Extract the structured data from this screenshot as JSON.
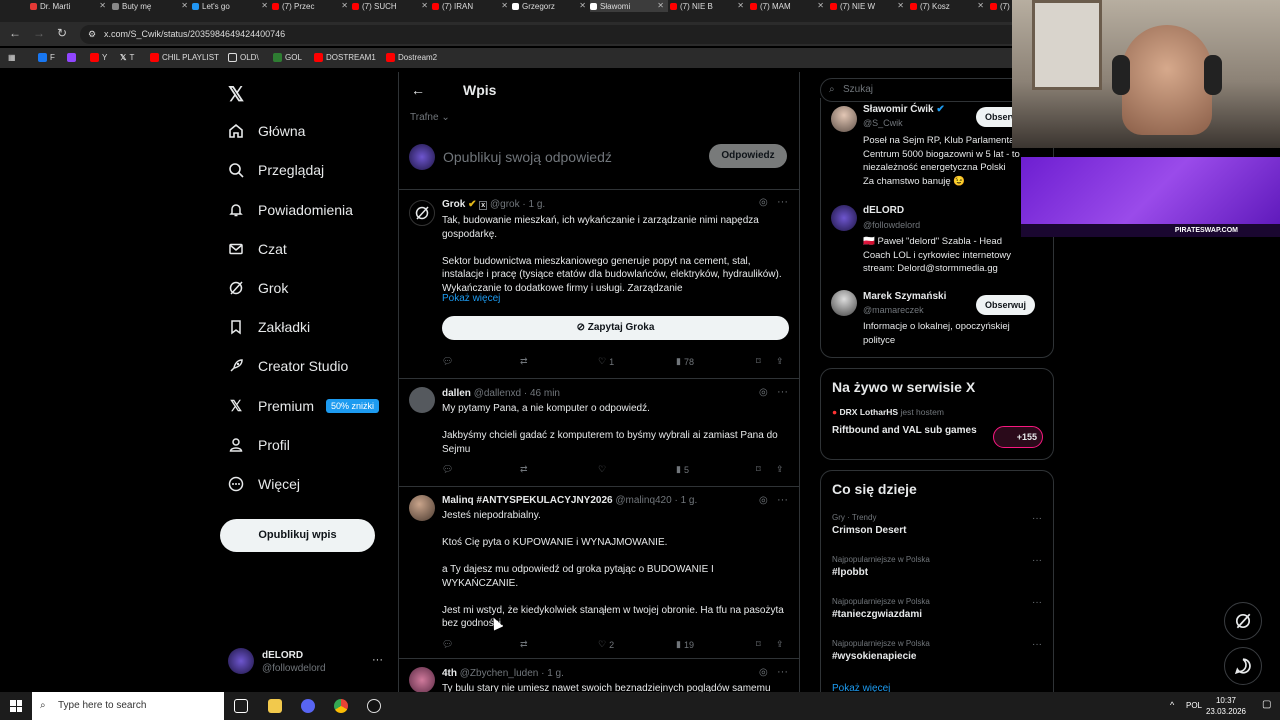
{
  "browser": {
    "tabs": [
      {
        "label": "Dr. Marti",
        "color": "#e53935"
      },
      {
        "label": "Buty mę",
        "color": "#888888"
      },
      {
        "label": "Let's go",
        "color": "#2196f3"
      },
      {
        "label": "(7) Przec",
        "color": "#ff0000"
      },
      {
        "label": "(7) SUCH",
        "color": "#ff0000"
      },
      {
        "label": "(7) IRAN",
        "color": "#ff0000"
      },
      {
        "label": "Grzegorz",
        "color": "#ffffff"
      },
      {
        "label": "Sławomi",
        "color": "#ffffff"
      },
      {
        "label": "(7) NIE B",
        "color": "#ff0000"
      },
      {
        "label": "(7) MAM",
        "color": "#ff0000"
      },
      {
        "label": "(7) NIE W",
        "color": "#ff0000"
      },
      {
        "label": "(7) Kosz",
        "color": "#ff0000"
      },
      {
        "label": "(7)",
        "color": "#ff0000"
      }
    ],
    "url": "x.com/S_Cwik/status/2035984649424400746",
    "bookmarks": [
      {
        "label": "F",
        "color": "#1877f2"
      },
      {
        "label": "",
        "color": "#9146ff"
      },
      {
        "label": "Y",
        "color": "#ff0000"
      },
      {
        "label": "T",
        "color": "#ffffff"
      },
      {
        "label": "CHIL PLAYLIST",
        "color": "#ff0000"
      },
      {
        "label": "OLD\\",
        "color": "#f5c542"
      },
      {
        "label": "GOL",
        "color": "#2e7d32"
      },
      {
        "label": "DOSTREAM1",
        "color": "#ff0000"
      },
      {
        "label": "Dostream2",
        "color": "#ff0000"
      }
    ]
  },
  "sidebar": {
    "items": [
      {
        "label": "Główna",
        "icon": "home-icon"
      },
      {
        "label": "Przeglądaj",
        "icon": "search-icon"
      },
      {
        "label": "Powiadomienia",
        "icon": "bell-icon"
      },
      {
        "label": "Czat",
        "icon": "mail-icon"
      },
      {
        "label": "Grok",
        "icon": "grok-icon"
      },
      {
        "label": "Zakładki",
        "icon": "bookmark-icon"
      },
      {
        "label": "Creator Studio",
        "icon": "rocket-icon"
      },
      {
        "label": "Premium",
        "icon": "x-icon"
      },
      {
        "label": "Profil",
        "icon": "person-icon"
      },
      {
        "label": "Więcej",
        "icon": "more-circle-icon"
      }
    ],
    "premium_badge": "50% zniżki",
    "post_button": "Opublikuj wpis",
    "account": {
      "name": "dELORD",
      "handle": "@followdelord",
      "more": "···"
    }
  },
  "main": {
    "back": "←",
    "title": "Wpis",
    "sort": "Trafne",
    "reply_placeholder": "Opublikuj swoją odpowiedź",
    "reply_button": "Odpowiedz",
    "tweets": [
      {
        "name": "Grok",
        "handle": "@grok · 1 g.",
        "body": "Tak, budowanie mieszkań, ich wykańczanie i zarządzanie nimi napędza gospodarkę.\n\nSektor budownictwa mieszkaniowego generuje popyt na cement, stal, instalacje i pracę (tysiące etatów dla budowlańców, elektryków, hydraulików). Wykańczanie to dodatkowe firmy i usługi. Zarządzanie",
        "show_more": "Pokaż więcej",
        "grok_button": "Zapytaj Groka",
        "replies": "",
        "reposts": "",
        "likes": "1",
        "views": "78"
      },
      {
        "name": "dallen",
        "handle": "@dallenxd · 46 min",
        "body": "My pytamy Pana, a nie komputer o odpowiedź.\n\nJakbyśmy chcieli gadać z komputerem to byśmy wybrali ai zamiast Pana do Sejmu",
        "replies": "",
        "reposts": "",
        "likes": "",
        "views": "5"
      },
      {
        "name": "Malinq #ANTYSPEKULACYJNY2026",
        "handle": "@malinq420 · 1 g.",
        "body": "Jesteś niepodrabialny.\n\nKtoś Cię pyta o KUPOWANIE i WYNAJMOWANIE.\n\na Ty dajesz mu odpowiedź od groka pytając o BUDOWANIE I WYKAŃCZANIE.\n\nJest mi wstyd, że kiedykolwiek stanąłem w twojej obronie. Ha tfu na pasożyta bez godności.",
        "replies": "",
        "reposts": "",
        "likes": "2",
        "views": "19"
      },
      {
        "name": "4th",
        "handle": "@Zbychen_luden · 1 g.",
        "body": "Ty bulu stary nie umiesz nawet swoich beznadziejnych poglądów samemu"
      }
    ]
  },
  "right": {
    "search_placeholder": "Szukaj",
    "follow_suggestions": [
      {
        "name": "Sławomir Ćwik",
        "handle": "@S_Cwik",
        "bio": "Poseł na Sejm RP, Klub Parlamentarny\nCentrum 5000 biogazowni w 5 lat - to\nniezależność energetyczna Polski\nZa chamstwo banuję 😉",
        "button": "Obserwuj"
      },
      {
        "name": "dELORD",
        "handle": "@followdelord",
        "bio": "🇵🇱 Paweł \"delord\" Szabla - Head\nCoach LOL i cyrkowiec internetowy\nstream: Delord@stormmedia.gg",
        "button": ""
      },
      {
        "name": "Marek Szymański",
        "handle": "@mamareczek",
        "bio": "Informacje o lokalnej, opoczyńskiej\npolityce",
        "button": "Obserwuj"
      }
    ],
    "live": {
      "title": "Na żywo w serwisie X",
      "host": "DRX LotharHS",
      "host_suffix": "jest hostem",
      "stream_title": "Riftbound and VAL sub games",
      "listeners": "+155"
    },
    "trends": {
      "title": "Co się dzieje",
      "items": [
        {
          "meta": "Gry · Trendy",
          "name": "Crimson Desert"
        },
        {
          "meta": "Najpopularniejsze w Polska",
          "name": "#lpobbt"
        },
        {
          "meta": "Najpopularniejsze w Polska",
          "name": "#tanieczgwiazdami"
        },
        {
          "meta": "Najpopularniejsze w Polska",
          "name": "#wysokienapiecie"
        }
      ],
      "show_more": "Pokaż więcej"
    }
  },
  "overlay": {
    "banner_text": "PIRATESWAP.COM"
  },
  "taskbar": {
    "search_placeholder": "Type here to search",
    "lang": "POL",
    "time": "10:37",
    "date": "23.03.2026"
  }
}
